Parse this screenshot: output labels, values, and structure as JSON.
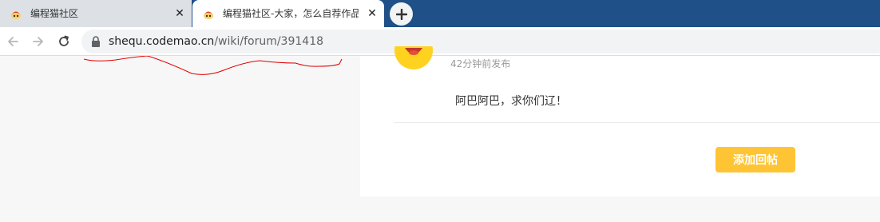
{
  "browser": {
    "tabs": [
      {
        "title": "编程猫社区",
        "active": false
      },
      {
        "title": "编程猫社区-大家，怎么自荐作品",
        "active": true
      }
    ],
    "close_glyph": "✕",
    "new_tab_icon": "plus-icon",
    "back_icon": "arrow-left-icon",
    "forward_icon": "arrow-right-icon",
    "reload_icon": "reload-icon",
    "address": {
      "host": "shequ.codemao.cn",
      "path": "/wiki/forum/391418"
    }
  },
  "page": {
    "reply": {
      "time": "42分钟前发布",
      "content": "阿巴阿巴，求你们辽！"
    },
    "add_reply_label": "添加回帖",
    "colors": {
      "accent": "#fec433",
      "tabstrip": "#1f5087",
      "annotation": "#e00000"
    }
  }
}
